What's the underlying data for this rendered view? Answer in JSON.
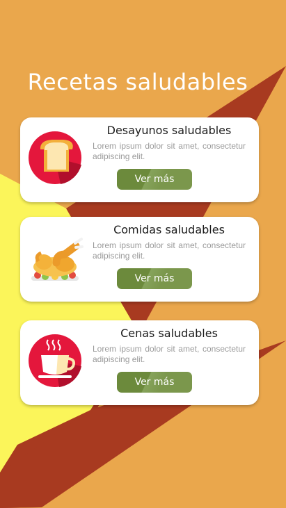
{
  "page": {
    "title": "Recetas saludables"
  },
  "colors": {
    "background": "#eaa74c",
    "dark_red": "#a83a20",
    "yellow": "#fbf55a",
    "button": "#7b974c",
    "card": "#ffffff"
  },
  "cards": [
    {
      "title": "Desayunos saludables",
      "text": "Lorem ipsum dolor sit amet, consectetur adipiscing elit.",
      "button": "Ver más",
      "icon": "toast-icon"
    },
    {
      "title": "Comidas saludables",
      "text": "Lorem ipsum dolor sit amet, consectetur adipiscing elit.",
      "button": "Ver más",
      "icon": "roast-chicken-icon"
    },
    {
      "title": "Cenas saludables",
      "text": "Lorem ipsum dolor sit amet, consectetur adipiscing elit.",
      "button": "Ver más",
      "icon": "coffee-cup-icon"
    }
  ]
}
